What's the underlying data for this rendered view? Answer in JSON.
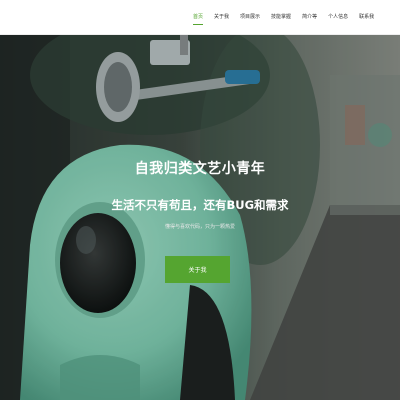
{
  "nav": {
    "items": [
      {
        "label": "首页",
        "active": true
      },
      {
        "label": "关于我",
        "active": false
      },
      {
        "label": "项目展示",
        "active": false
      },
      {
        "label": "技能掌握",
        "active": false
      },
      {
        "label": "简介等",
        "active": false
      },
      {
        "label": "个人信息",
        "active": false
      },
      {
        "label": "联系我",
        "active": false
      }
    ]
  },
  "hero": {
    "title": "自我归类文艺小青年",
    "subtitle": "生活不只有苟且，还有BUG和需求",
    "description": "懂得与喜欢代码，只为一颗热爱",
    "button_label": "关于我",
    "background_image": "green-scooter-street-photo"
  },
  "colors": {
    "accent": "#55a530",
    "scooter": "#7ecab0",
    "nav_text": "#333333"
  }
}
